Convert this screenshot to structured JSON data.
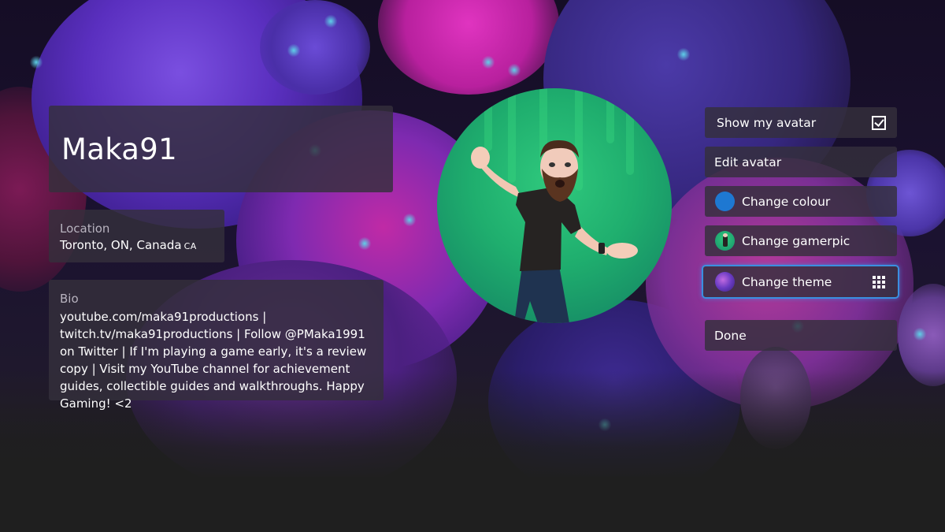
{
  "profile": {
    "gamertag": "Maka91",
    "location": {
      "label": "Location",
      "value": "Toronto, ON, Canada",
      "country_code": "CA"
    },
    "bio": {
      "label": "Bio",
      "value": "youtube.com/maka91productions | twitch.tv/maka91productions | Follow @PMaka1991 on Twitter | If I'm playing a game early, it's a review copy | Visit my YouTube channel for achievement guides, collectible guides and walkthroughs. Happy Gaming! <2"
    },
    "avatar": {
      "icon": "avatar-image",
      "background_color": "#1fae6e"
    }
  },
  "menu": {
    "items": [
      {
        "id": "show-avatar",
        "label": "Show my avatar",
        "type": "checkbox",
        "checked": true,
        "icon": "checkbox-checked-icon"
      },
      {
        "id": "edit-avatar",
        "label": "Edit avatar",
        "type": "button"
      },
      {
        "id": "change-colour",
        "label": "Change colour",
        "type": "button",
        "icon": "colour-swatch-icon",
        "swatch_color": "#1e78d2"
      },
      {
        "id": "change-gamerpic",
        "label": "Change gamerpic",
        "type": "button",
        "icon": "gamerpic-thumbnail"
      },
      {
        "id": "change-theme",
        "label": "Change theme",
        "type": "button",
        "icon": "theme-thumbnail",
        "focused": true,
        "trailing_icon": "view-options-grid-icon"
      },
      {
        "id": "done",
        "label": "Done",
        "type": "button"
      }
    ]
  },
  "colors": {
    "focus_ring": "#3a8fe0",
    "panel": "#34303c",
    "accent_swatch": "#1e78d2"
  }
}
